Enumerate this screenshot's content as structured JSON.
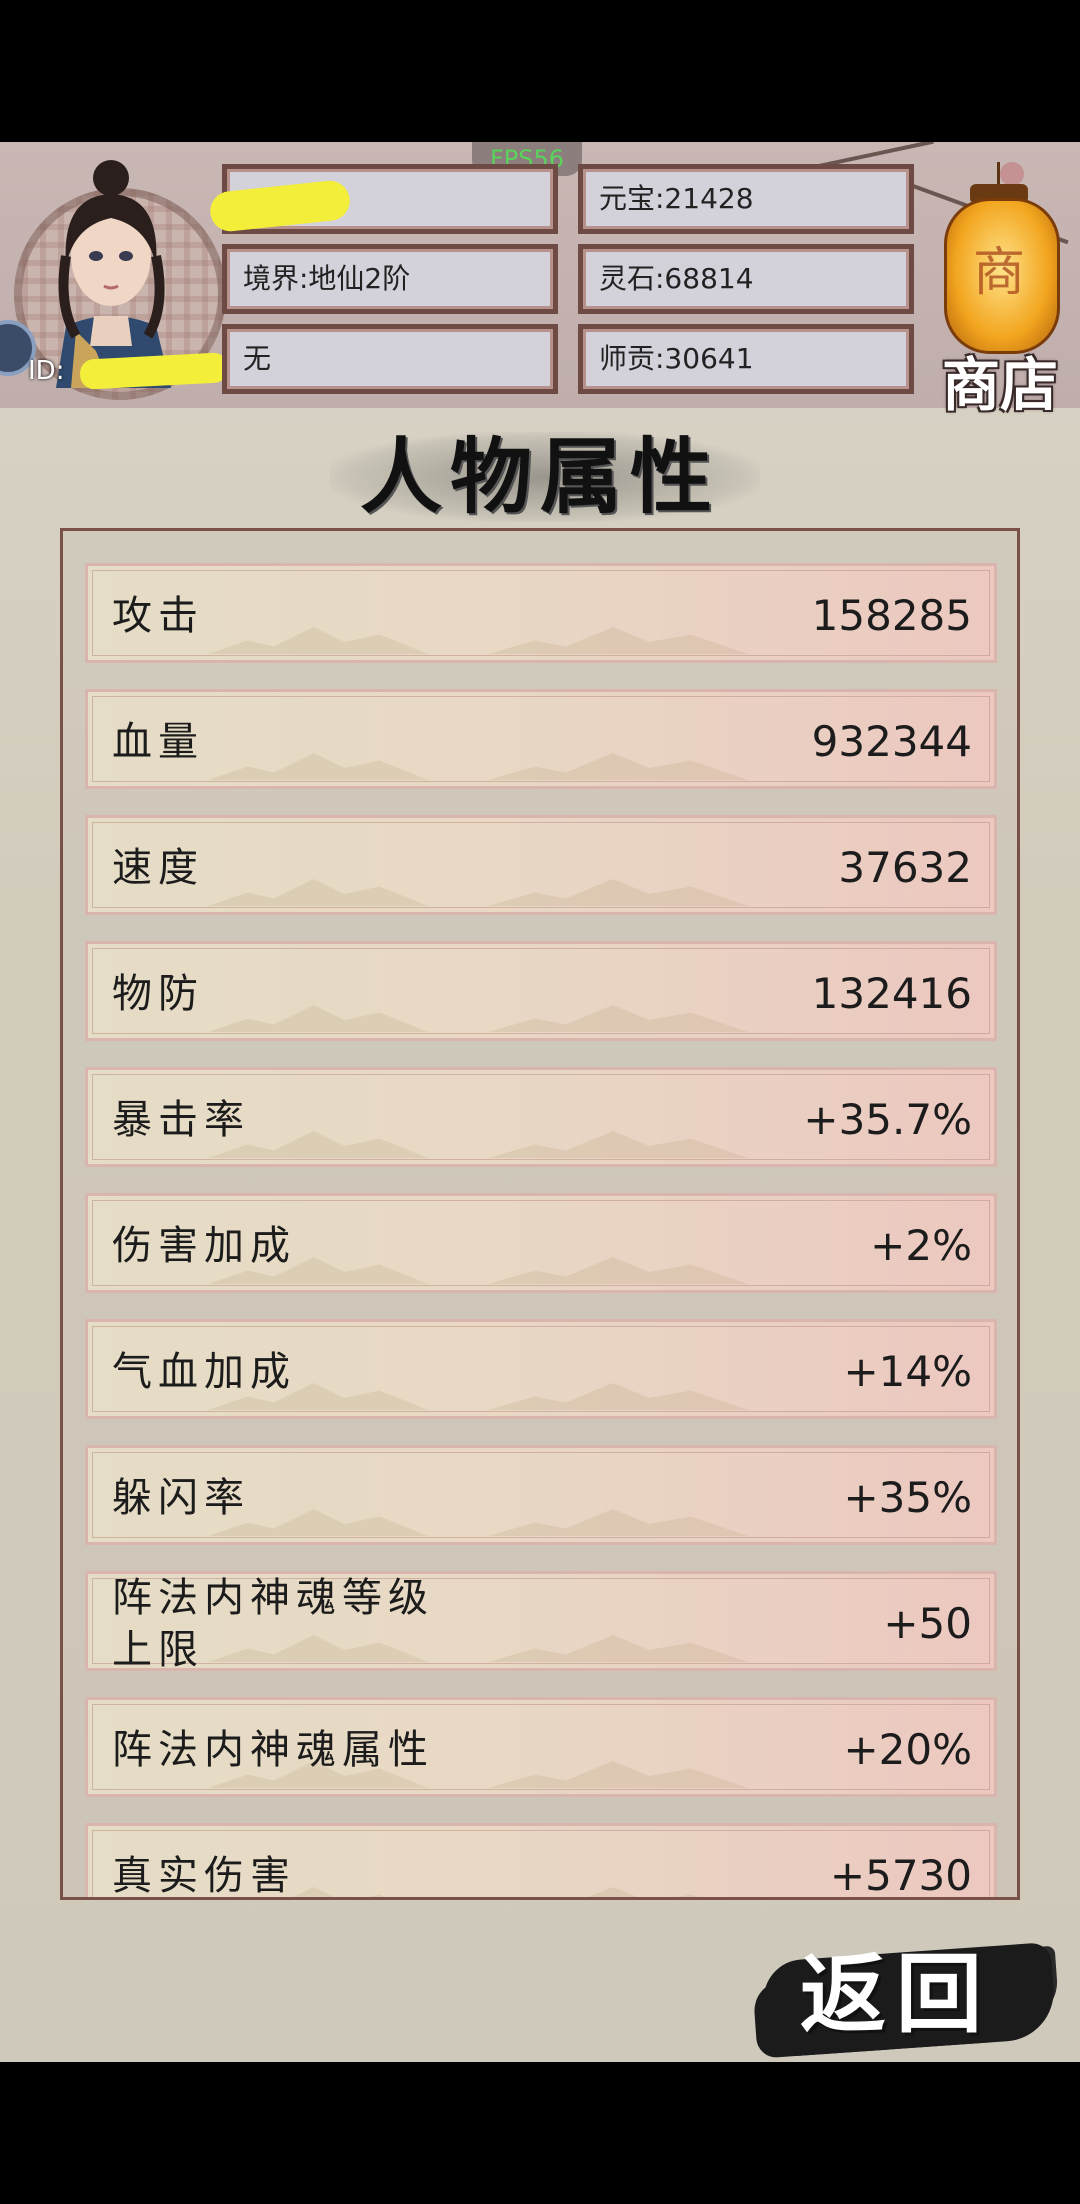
{
  "header": {
    "fps": "FPS56",
    "id_label": "ID:",
    "realm": "境界:地仙2阶",
    "sect": "无",
    "yuanbao": "元宝:21428",
    "lingshi": "灵石:68814",
    "shigong": "师贡:30641",
    "shop_label": "商店",
    "lantern_glyph": "商"
  },
  "title": "人物属性",
  "attributes": [
    {
      "label": "攻击",
      "value": "158285"
    },
    {
      "label": "血量",
      "value": "932344"
    },
    {
      "label": "速度",
      "value": "37632"
    },
    {
      "label": "物防",
      "value": "132416"
    },
    {
      "label": "暴击率",
      "value": "+35.7%"
    },
    {
      "label": "伤害加成",
      "value": "+2%"
    },
    {
      "label": "气血加成",
      "value": "+14%"
    },
    {
      "label": "躲闪率",
      "value": "+35%"
    },
    {
      "label": "阵法内神魂等级上限",
      "value": "+50"
    },
    {
      "label": "阵法内神魂属性",
      "value": "+20%"
    },
    {
      "label": "真实伤害",
      "value": "+5730"
    }
  ],
  "back_label": "返回",
  "colors": {
    "redaction": "#f2ee3a",
    "frame": "#6e4a44",
    "fps_text": "#5ad35a"
  }
}
